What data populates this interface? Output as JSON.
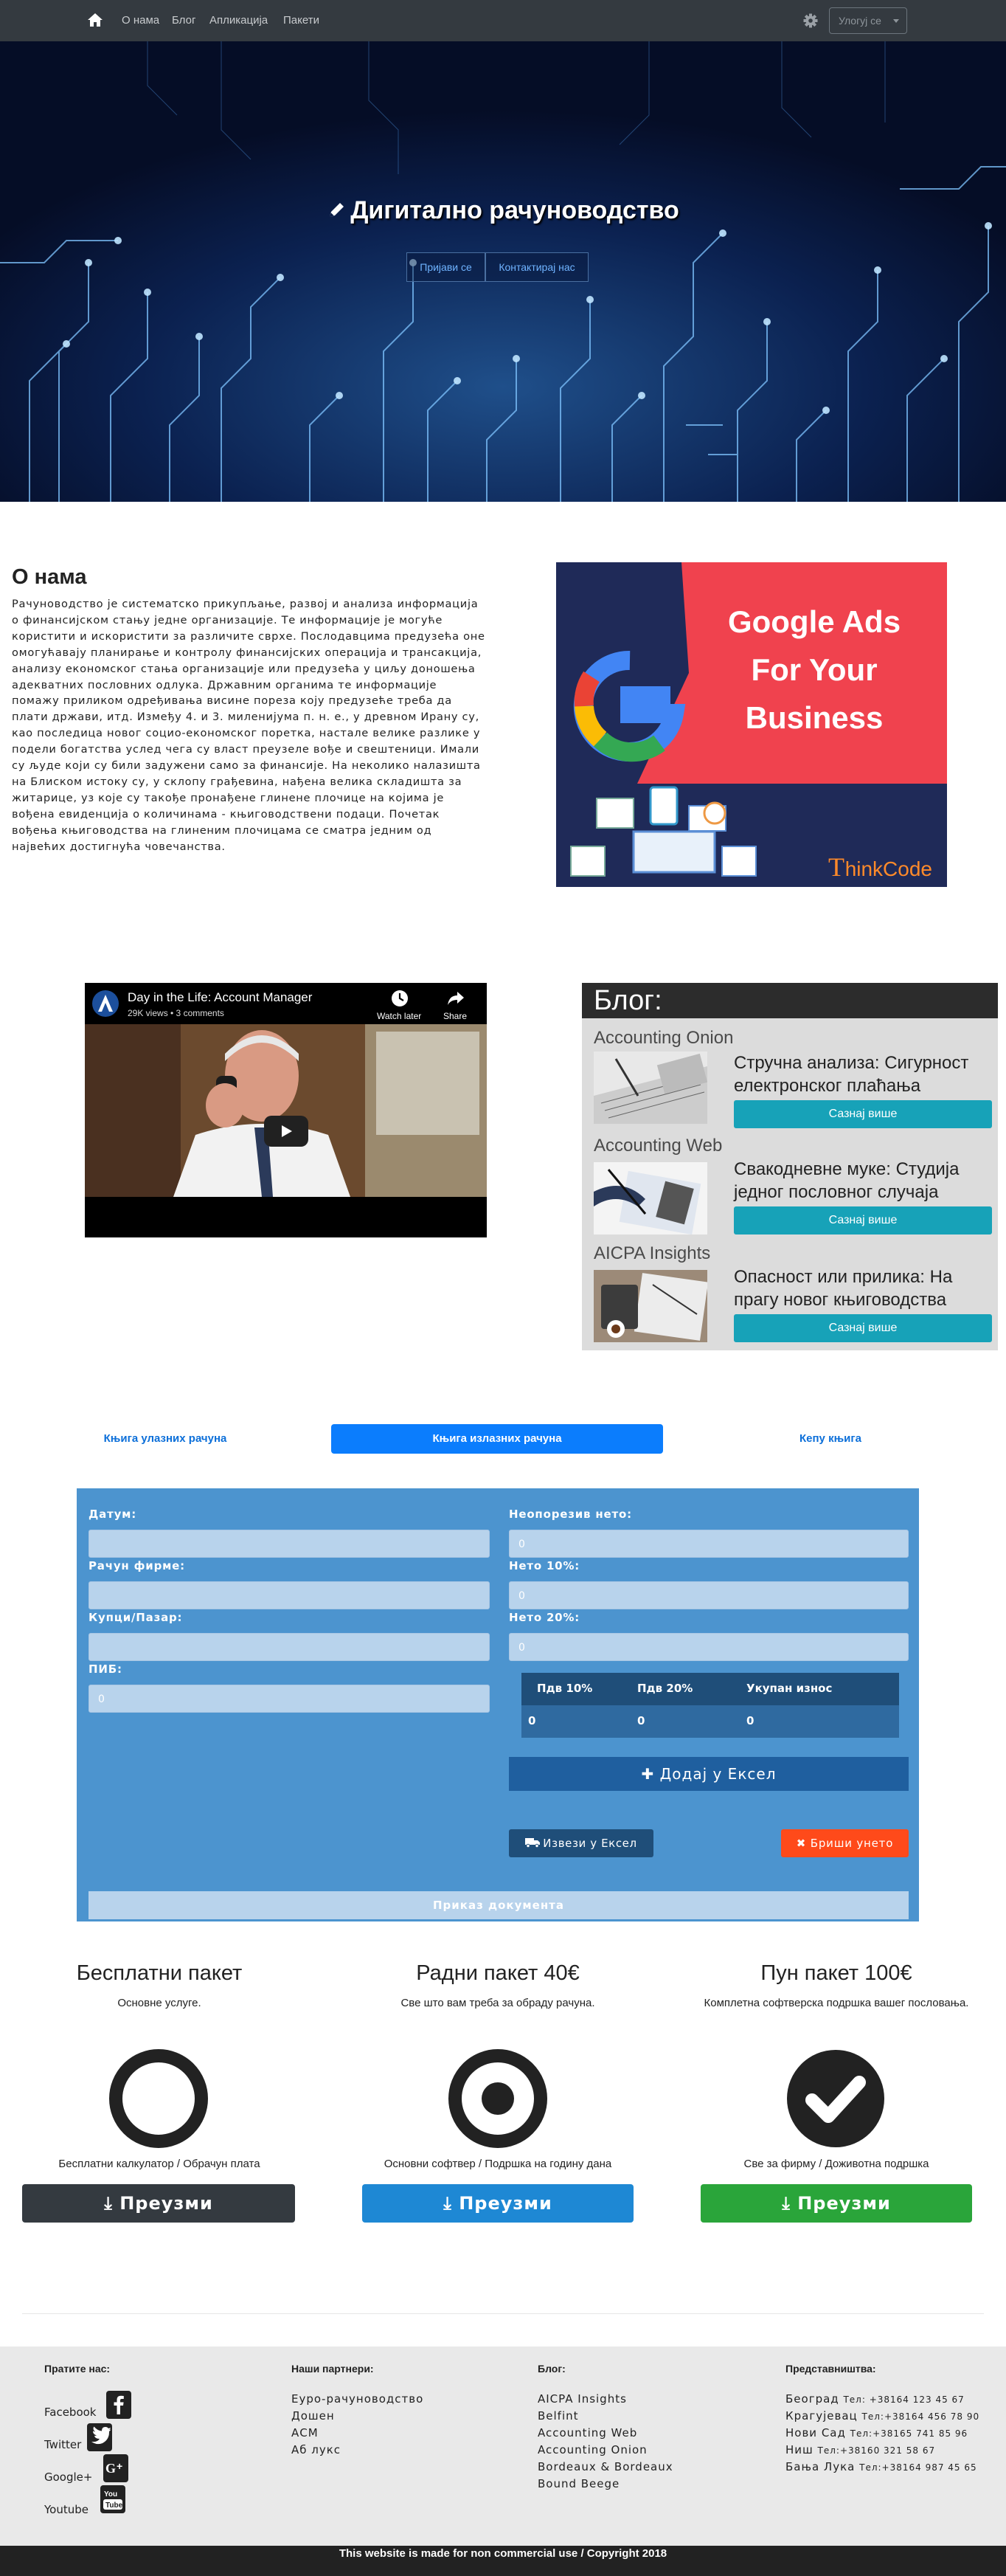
{
  "navbar": {
    "links": [
      "О нама",
      "Блог",
      "Апликација",
      "Пакети"
    ],
    "login_label": "Улогуј се",
    "colors": {
      "background": "#343a40"
    }
  },
  "hero": {
    "title": "Дигитално рачуноводство",
    "buttons": [
      "Пријави се",
      "Контактирај нас"
    ]
  },
  "about": {
    "title": "О нама",
    "text": "Рачуноводство је систематско прикупљање, развој и анализа информација о финансијском стању једне организације. Те информације је могуће користити и искористити за различите сврхе. Послодавцима предузећа оне омогућавају планирање и контролу финансијских операција и трансакција, анализу економског стања организације или предузећа у циљу доношења адекватних пословних одлука. Државним органима те информације помажу приликом одређивања висине пореза коју предузеће треба да плати држави, итд. Између 4. и 3. миленијума п. н. е., у древном Ирану су, као последица новог социо-економског поретка, настале велике разлике у подели богатства услед чега су власт преузеле вође и свештеници. Имали су људе који су били задужени само за финансије. На неколико налазишта на Блиском истоку су, у склопу грађевина, нађена велика складишта за житарице, уз које су такође пронађене глинене плочице на којима је вођена евиденција о количинама - књиговодствени подаци. Почетак вођења књиговодства на глиненим плочицама се сматра једним од највећих достигнућа човечанства.",
    "banner": {
      "line1": "Google Ads",
      "line2": "For Your",
      "line3": "Business",
      "brand": "hinkCode"
    }
  },
  "video": {
    "title": "Day in the Life: Account Manager",
    "meta": "29K views • 3 comments",
    "watch_later": "Watch later",
    "share": "Share"
  },
  "blog": {
    "heading": "Блог:",
    "posts": [
      {
        "source": "Accounting Onion",
        "title": "Стручна анализа: Сигурност електронског плаћања",
        "button": "Сазнај више"
      },
      {
        "source": "Accounting Web",
        "title": "Свакодневне муке: Студија једног пословног случаја",
        "button": "Сазнај више"
      },
      {
        "source": "AICPA Insights",
        "title": "Опасност или прилика: На прагу новог књиговодства",
        "button": "Сазнај више"
      }
    ]
  },
  "tabs": [
    "Књига улазних рачуна",
    "Књига излазних рачуна",
    "Кепу књига"
  ],
  "form": {
    "left": [
      {
        "label": "Датум:",
        "value": ""
      },
      {
        "label": "Рачун фирме:",
        "value": ""
      },
      {
        "label": "Купци/Пазар:",
        "value": ""
      },
      {
        "label": "ПИБ:",
        "value": "0"
      }
    ],
    "right": [
      {
        "label": "Неопорезив нето:",
        "value": "0"
      },
      {
        "label": "Нето 10%:",
        "value": "0"
      },
      {
        "label": "Нето 20%:",
        "value": "0"
      }
    ],
    "table": {
      "headers": [
        "Пдв 10%",
        "Пдв 20%",
        "Укупан износ"
      ],
      "row": [
        "0",
        "0",
        "0"
      ]
    },
    "add_button": "Додај у Ексел",
    "export_button": "Извези у Ексел",
    "clear_button": "Бриши унето",
    "show_button": "Приказ документа"
  },
  "packages": [
    {
      "title": "Бесплатни пакет",
      "subtitle": "Основне услуге.",
      "feature": "Бесплатни калкулатор / Обрачун плата",
      "button": "Преузми",
      "color": "#343a40",
      "icon": "empty-circle-icon"
    },
    {
      "title": "Радни пакет 40€",
      "subtitle": "Све што вам треба за обраду рачуна.",
      "feature": "Основни софтвер / Подршка на годину дана",
      "button": "Преузми",
      "color": "#1e88d4",
      "icon": "dot-circle-icon"
    },
    {
      "title": "Пун пакет 100€",
      "subtitle": "Комплетна софтверска подршка вашег пословања.",
      "feature": "Све за фирму / Доживотна подршка",
      "button": "Преузми",
      "color": "#2aa53a",
      "icon": "check-circle-icon"
    }
  ],
  "footer": {
    "follow_heading": "Пратите нас:",
    "social": [
      "Facebook",
      "Twitter",
      "Google+",
      "Youtube"
    ],
    "partners_heading": "Наши партнери:",
    "partners": [
      "Еуро-рачуноводство",
      "Дошен",
      "АСМ",
      "Аб лукс"
    ],
    "blog_heading": "Блог:",
    "blog_links": [
      "AICPA Insights",
      "Belfint",
      "Accounting Web",
      "Accounting Onion",
      "Bordeaux & Bordeaux",
      "Bound Beege"
    ],
    "offices_heading": "Представништва:",
    "offices": [
      {
        "city": "Београд",
        "tel": "Тел: +38164 123 45 67"
      },
      {
        "city": "Крагујевац",
        "tel": "Тел:+38164 456 78 90"
      },
      {
        "city": "Нови Сад",
        "tel": "Тел:+38165 741 85 96"
      },
      {
        "city": "Ниш",
        "tel": "Тел:+38160 321 58 67"
      },
      {
        "city": "Бања Лука",
        "tel": "Тел:+38164 987 45 65"
      }
    ],
    "copyright": "This website is made for non commercial use / Copyright 2018"
  }
}
